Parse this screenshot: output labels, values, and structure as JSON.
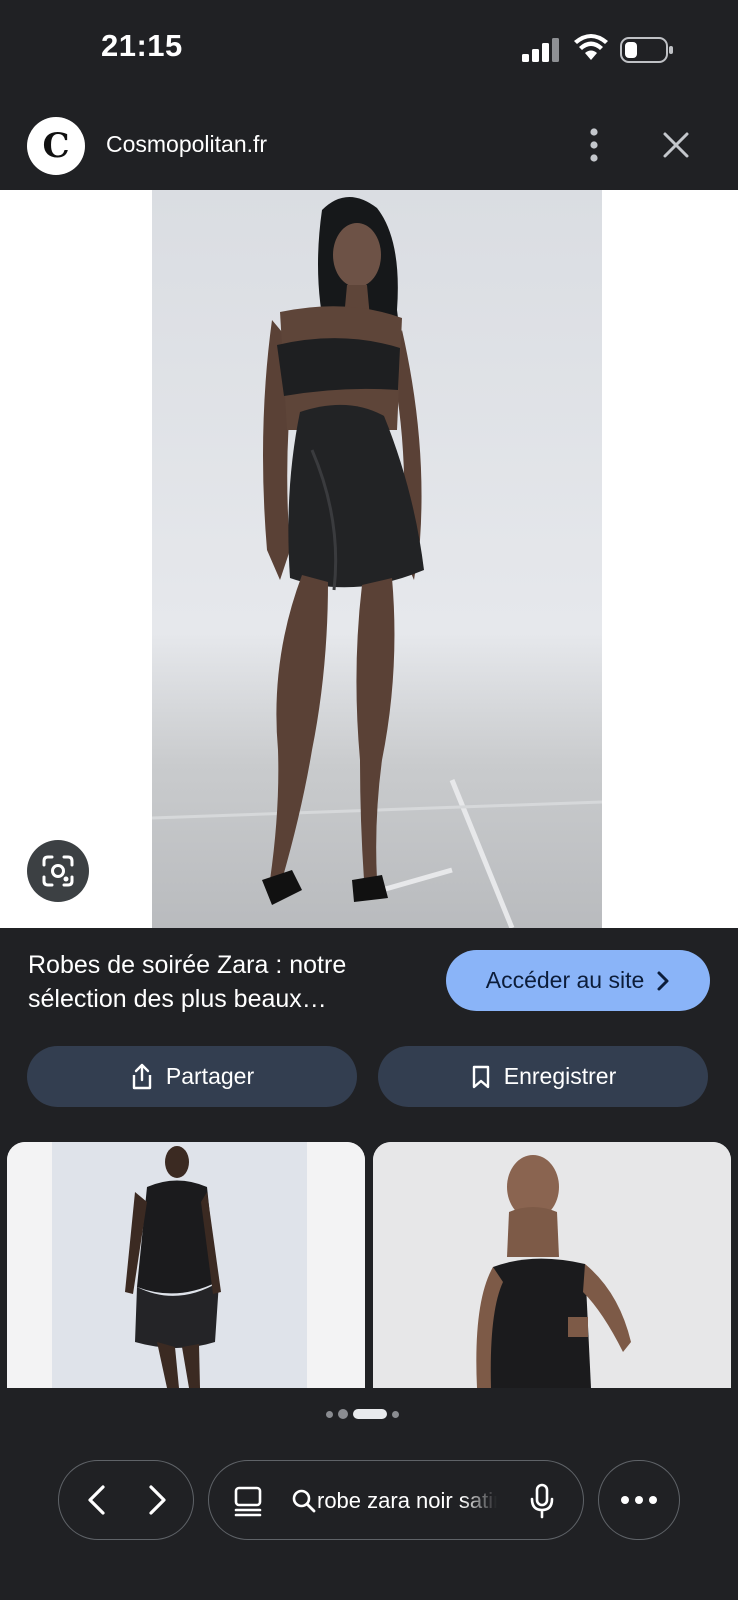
{
  "status_bar": {
    "time": "21:15"
  },
  "header": {
    "logo_letter": "C",
    "site_name": "Cosmopolitan.fr"
  },
  "result": {
    "title": "Robes de soirée Zara : notre sélection des plus beaux…",
    "visit_label": "Accéder au site",
    "share_label": "Partager",
    "save_label": "Enregistrer"
  },
  "pager": {
    "count": 4,
    "active_index": 2
  },
  "toolbar": {
    "search_query": "robe zara noir satin"
  },
  "colors": {
    "background": "#202124",
    "accent_button": "#8ab4f8",
    "secondary_button": "#333e50"
  },
  "icons": [
    "signal-icon",
    "wifi-icon",
    "battery-icon",
    "more-vert-icon",
    "close-icon",
    "lens-icon",
    "share-icon",
    "bookmark-icon",
    "chevron-right-icon",
    "back-arrow-icon",
    "forward-arrow-icon",
    "tabs-icon",
    "search-icon",
    "mic-icon",
    "more-horiz-icon"
  ]
}
